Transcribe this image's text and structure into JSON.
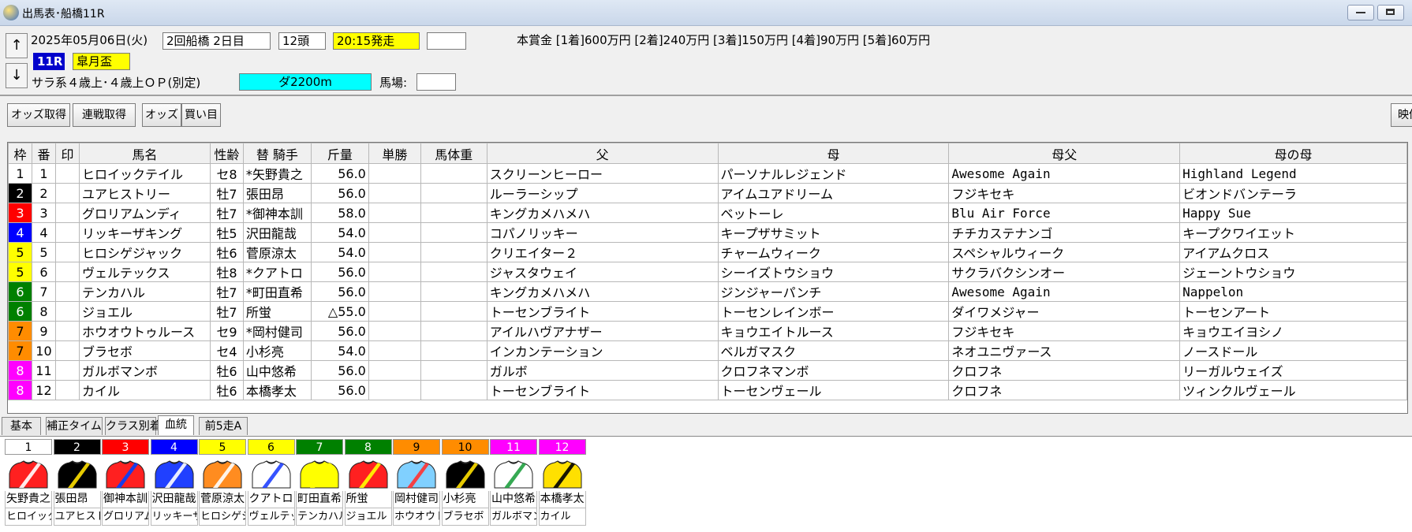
{
  "window": {
    "title": "出馬表･船橋11R"
  },
  "nav": {
    "up": "↑",
    "down": "↓"
  },
  "race": {
    "date": "2025年05月06日(火)",
    "meeting": "2回船橋 2日目",
    "runners": "12頭",
    "post_time": "20:15発走",
    "race_no": "11R",
    "race_name": "皐月盃",
    "conditions": "サラ系４歳上･４歳上ＯＰ(別定)",
    "course": "ダ2200m",
    "track_label": "馬場:",
    "track_value": "",
    "extra_value": "",
    "prize": "本賞金 [1着]600万円 [2着]240万円 [3着]150万円 [4着]90万円 [5着]60万円"
  },
  "toolbar": {
    "odds_fetch": "オッズ取得",
    "renpuku_fetch": "連戦取得",
    "odds": "オッズ",
    "kaime": "買い目",
    "video": "映像表"
  },
  "table": {
    "headers": {
      "waku": "枠",
      "ban": "番",
      "mark": "印",
      "name": "馬名",
      "sexage": "性齢",
      "jockey": "替 騎手",
      "weight": "斤量",
      "tansho": "単勝",
      "bataiju": "馬体重",
      "sire": "父",
      "dam": "母",
      "damsire": "母父",
      "damdam": "母の母"
    },
    "rows": [
      {
        "waku": "1",
        "ban": "1",
        "name": "ヒロイックテイル",
        "sexage": "セ8",
        "jockey": "*矢野貴之",
        "weight": "56.0",
        "sire": "スクリーンヒーロー",
        "dam": "パーソナルレジェンド",
        "damsire": "Awesome Again",
        "damdam": "Highland Legend"
      },
      {
        "waku": "2",
        "ban": "2",
        "name": "ユアヒストリー",
        "sexage": "牡7",
        "jockey": "張田昂",
        "weight": "56.0",
        "sire": "ルーラーシップ",
        "dam": "アイムユアドリーム",
        "damsire": "フジキセキ",
        "damdam": "ビオンドバンテーラ"
      },
      {
        "waku": "3",
        "ban": "3",
        "name": "グロリアムンディ",
        "sexage": "牡7",
        "jockey": "*御神本訓",
        "weight": "58.0",
        "sire": "キングカメハメハ",
        "dam": "ベットーレ",
        "damsire": "Blu Air Force",
        "damdam": "Happy Sue"
      },
      {
        "waku": "4",
        "ban": "4",
        "name": "リッキーザキング",
        "sexage": "牡5",
        "jockey": "沢田龍哉",
        "weight": "54.0",
        "sire": "コパノリッキー",
        "dam": "キープザサミット",
        "damsire": "チチカステナンゴ",
        "damdam": "キープクワイエット"
      },
      {
        "waku": "5",
        "ban": "5",
        "name": "ヒロシゲジャック",
        "sexage": "牡6",
        "jockey": "菅原涼太",
        "weight": "54.0",
        "sire": "クリエイター２",
        "dam": "チャームウィーク",
        "damsire": "スペシャルウィーク",
        "damdam": "アイアムクロス"
      },
      {
        "waku": "5",
        "ban": "6",
        "name": "ヴェルテックス",
        "sexage": "牡8",
        "jockey": "*クアトロ",
        "weight": "56.0",
        "sire": "ジャスタウェイ",
        "dam": "シーイズトウショウ",
        "damsire": "サクラバクシンオー",
        "damdam": "ジェーントウショウ"
      },
      {
        "waku": "6",
        "ban": "7",
        "name": "テンカハル",
        "sexage": "牡7",
        "jockey": "*町田直希",
        "weight": "56.0",
        "sire": "キングカメハメハ",
        "dam": "ジンジャーパンチ",
        "damsire": "Awesome Again",
        "damdam": "Nappelon"
      },
      {
        "waku": "6",
        "ban": "8",
        "name": "ジョエル",
        "sexage": "牡7",
        "jockey": "所蛍",
        "weight": "△55.0",
        "sire": "トーセンブライト",
        "dam": "トーセンレインボー",
        "damsire": "ダイワメジャー",
        "damdam": "トーセンアート"
      },
      {
        "waku": "7",
        "ban": "9",
        "name": "ホウオウトゥルース",
        "sexage": "セ9",
        "jockey": "*岡村健司",
        "weight": "56.0",
        "sire": "アイルハヴアナザー",
        "dam": "キョウエイトルース",
        "damsire": "フジキセキ",
        "damdam": "キョウエイヨシノ"
      },
      {
        "waku": "7",
        "ban": "10",
        "name": "ブラセボ",
        "sexage": "セ4",
        "jockey": "小杉亮",
        "weight": "54.0",
        "sire": "インカンテーション",
        "dam": "ベルガマスク",
        "damsire": "ネオユニヴァース",
        "damdam": "ノースドール"
      },
      {
        "waku": "8",
        "ban": "11",
        "name": "ガルボマンボ",
        "sexage": "牡6",
        "jockey": "山中悠希",
        "weight": "56.0",
        "sire": "ガルボ",
        "dam": "クロフネマンボ",
        "damsire": "クロフネ",
        "damdam": "リーガルウェイズ"
      },
      {
        "waku": "8",
        "ban": "12",
        "name": "カイル",
        "sexage": "牡6",
        "jockey": "本橋孝太",
        "weight": "56.0",
        "sire": "トーセンブライト",
        "dam": "トーセンヴェール",
        "damsire": "クロフネ",
        "damdam": "ツィンクルヴェール"
      }
    ]
  },
  "tabs": [
    "基本",
    "補正タイム",
    "クラス別着",
    "血統",
    "前5走A"
  ],
  "silks": [
    {
      "num": "1",
      "jockey": "矢野貴之",
      "horse": "ヒロイック"
    },
    {
      "num": "2",
      "jockey": "張田昂",
      "horse": "ユアヒスト"
    },
    {
      "num": "3",
      "jockey": "御神本訓",
      "horse": "グロリアム"
    },
    {
      "num": "4",
      "jockey": "沢田龍哉",
      "horse": "リッキーザ"
    },
    {
      "num": "5",
      "jockey": "菅原涼太",
      "horse": "ヒロシゲシ"
    },
    {
      "num": "6",
      "jockey": "クアトロ",
      "horse": "ヴェルテッ"
    },
    {
      "num": "7",
      "jockey": "町田直希",
      "horse": "テンカハル"
    },
    {
      "num": "8",
      "jockey": "所蛍",
      "horse": "ジョエル"
    },
    {
      "num": "9",
      "jockey": "岡村健司",
      "horse": "ホウオウト"
    },
    {
      "num": "10",
      "jockey": "小杉亮",
      "horse": "ブラセボ"
    },
    {
      "num": "11",
      "jockey": "山中悠希",
      "horse": "ガルボマン"
    },
    {
      "num": "12",
      "jockey": "本橋孝太",
      "horse": "カイル"
    }
  ],
  "colors": {
    "waku": {
      "1": "#ffffff",
      "2": "#000000",
      "3": "#ff0000",
      "4": "#0000ff",
      "5": "#ffff00",
      "6": "#008000",
      "7": "#ff8c00",
      "8": "#ff00ff"
    },
    "race_no_bg": "#0000cc",
    "race_name_bg": "#ffff00",
    "post_time_bg": "#ffff00",
    "course_bg": "#00ffff",
    "silks": [
      {
        "body": "#ff2020",
        "pattern": "#ffffff"
      },
      {
        "body": "#000000",
        "pattern": "#ffe000"
      },
      {
        "body": "#ff2020",
        "pattern": "#0040ff"
      },
      {
        "body": "#2040ff",
        "pattern": "#ffffff"
      },
      {
        "body": "#ff8c20",
        "pattern": "#ffffff"
      },
      {
        "body": "#ffffff",
        "pattern": "#2040ff"
      },
      {
        "body": "#ffff00",
        "pattern": "#ffff00"
      },
      {
        "body": "#ff2020",
        "pattern": "#ffff00"
      },
      {
        "body": "#80d0ff",
        "pattern": "#ff3030"
      },
      {
        "body": "#000000",
        "pattern": "#ffe000"
      },
      {
        "body": "#ffffff",
        "pattern": "#20a040"
      },
      {
        "body": "#ffe000",
        "pattern": "#000000"
      }
    ]
  }
}
